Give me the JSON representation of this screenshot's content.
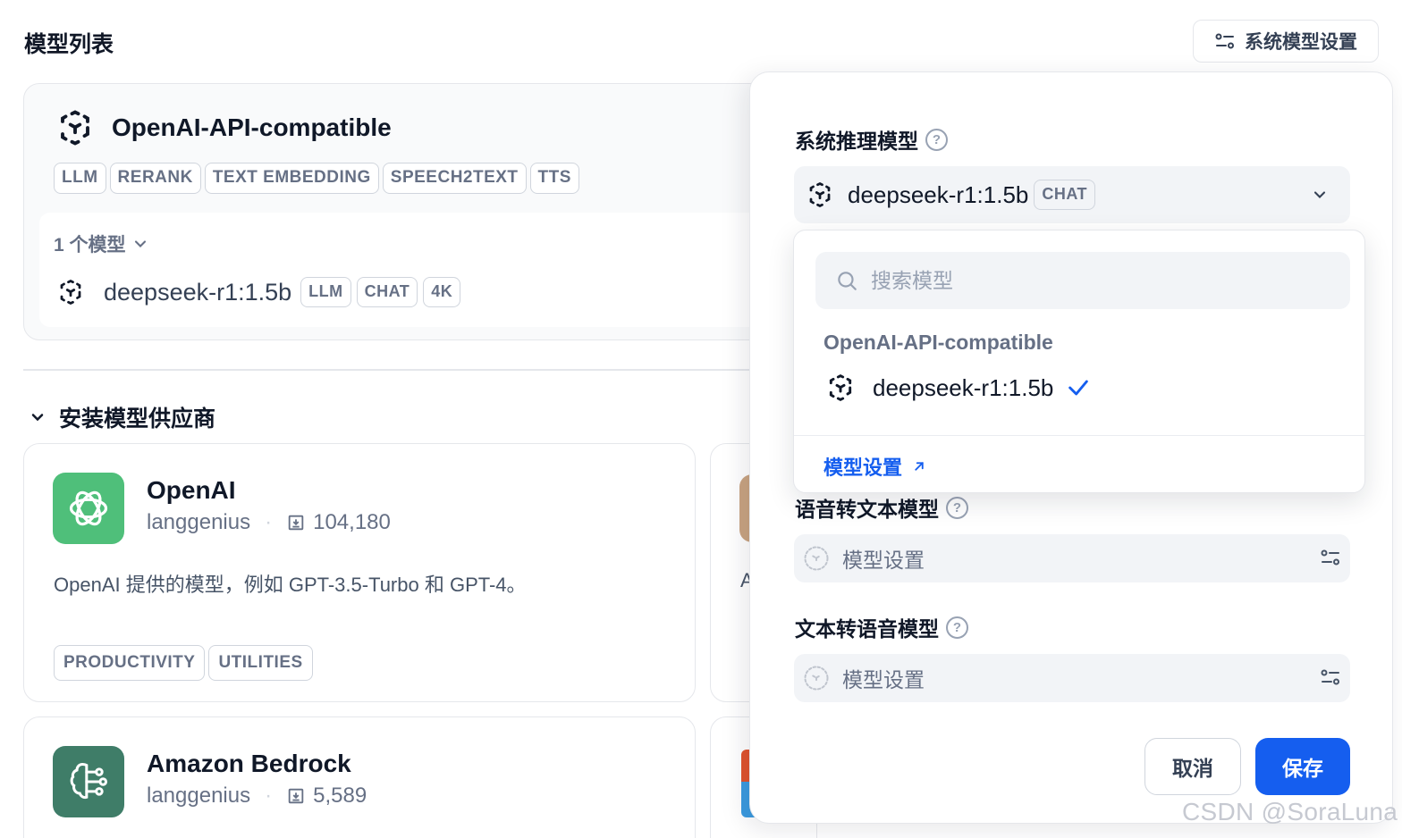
{
  "page": {
    "title": "模型列表"
  },
  "toolbar": {
    "system_model_settings_label": "系统模型设置"
  },
  "provider": {
    "name": "OpenAI-API-compatible",
    "tags": [
      "LLM",
      "RERANK",
      "TEXT EMBEDDING",
      "SPEECH2TEXT",
      "TTS"
    ],
    "model_count_label": "1 个模型",
    "models": [
      {
        "name": "deepseek-r1:1.5b",
        "tags": [
          "LLM",
          "CHAT",
          "4K"
        ]
      }
    ]
  },
  "install_section": {
    "title": "安装模型供应商"
  },
  "plugins": [
    {
      "name": "OpenAI",
      "author": "langgenius",
      "installs": "104,180",
      "description": "OpenAI 提供的模型，例如 GPT-3.5-Turbo 和 GPT-4。",
      "tags": [
        "PRODUCTIVITY",
        "UTILITIES"
      ],
      "logo_color": "#4fbf7a"
    },
    {
      "name": "Amazon Bedrock",
      "author": "langgenius",
      "installs": "5,589",
      "logo_color": "#3f7d68"
    }
  ],
  "partial_card": {
    "desc_initial": "A"
  },
  "panel": {
    "reasoning": {
      "label": "系统推理模型",
      "selected_model": "deepseek-r1:1.5b",
      "selected_tag": "CHAT"
    },
    "dropdown": {
      "search_placeholder": "搜索模型",
      "group_label": "OpenAI-API-compatible",
      "items": [
        {
          "name": "deepseek-r1:1.5b",
          "selected": true
        }
      ],
      "settings_link": "模型设置"
    },
    "speech2text": {
      "label": "语音转文本模型",
      "placeholder": "模型设置"
    },
    "tts": {
      "label": "文本转语音模型",
      "placeholder": "模型设置"
    },
    "cancel_label": "取消",
    "save_label": "保存"
  },
  "watermark": "CSDN @SoraLuna",
  "colors": {
    "primary": "#155eef",
    "check": "#155eef"
  }
}
